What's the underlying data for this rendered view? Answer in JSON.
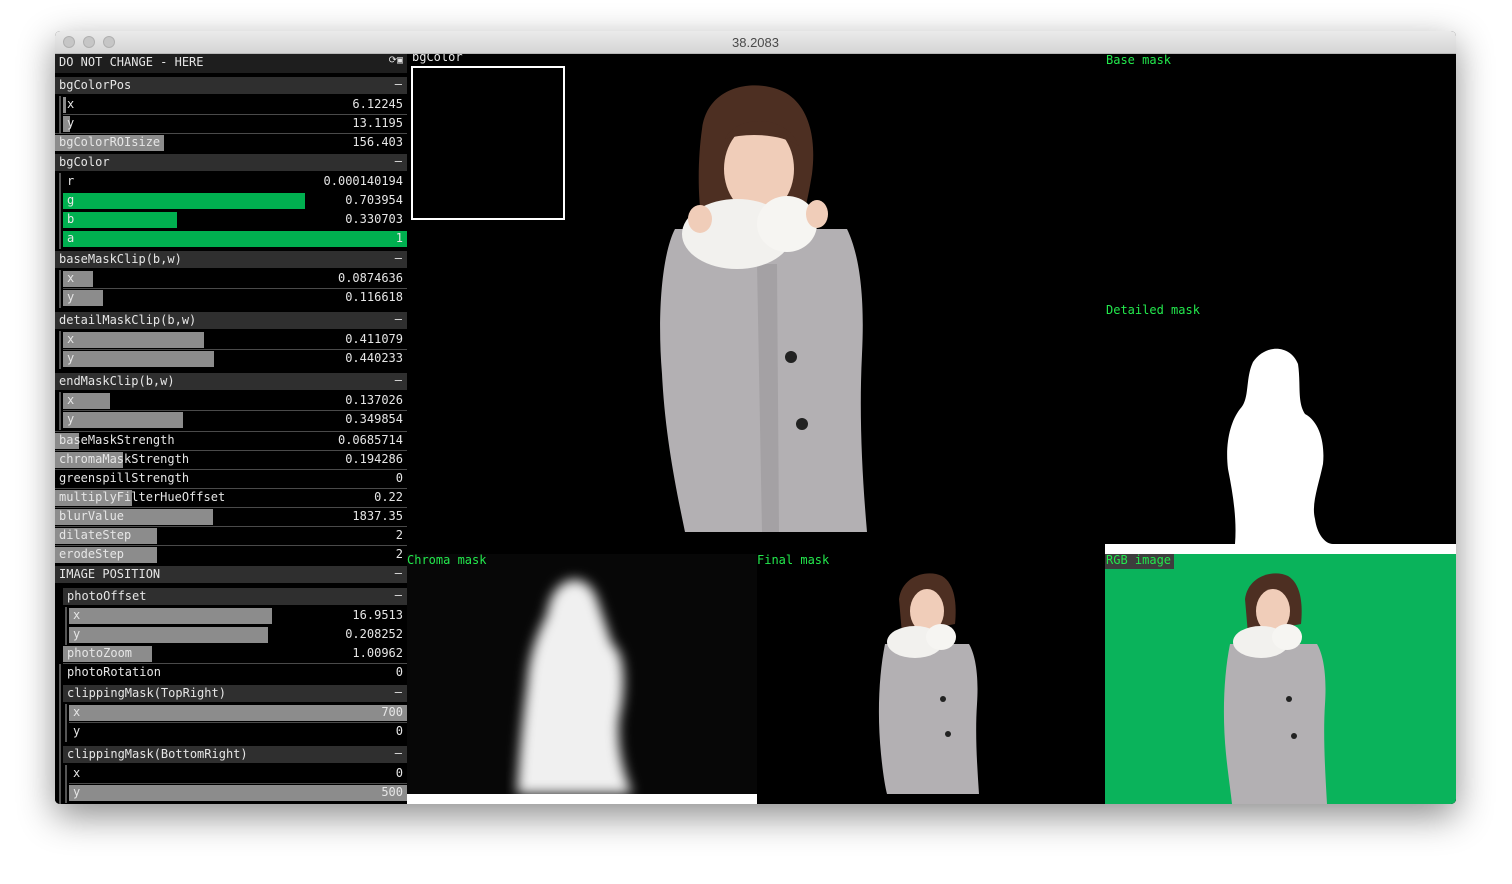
{
  "window": {
    "title": "38.2083"
  },
  "gui": {
    "title": "DO NOT CHANGE - HERE",
    "title_icons": [
      "refresh-icon",
      "save-icon"
    ],
    "groups": [
      {
        "name": "bgColorPos",
        "params": [
          {
            "label": "x",
            "value": "6.12245",
            "fill": 0.01
          },
          {
            "label": "y",
            "value": "13.1195",
            "fill": 0.02
          }
        ]
      },
      {
        "name": "bgColorROIsize",
        "value": "156.403",
        "fill": 0.31,
        "single": true
      },
      {
        "name": "bgColor",
        "params": [
          {
            "label": "r",
            "value": "0.000140194",
            "fill": 0.0
          },
          {
            "label": "g",
            "value": "0.703954",
            "fill": 0.704
          },
          {
            "label": "b",
            "value": "0.330703",
            "fill": 0.331
          },
          {
            "label": "a",
            "value": "1",
            "fill": 1.0
          }
        ]
      },
      {
        "name": "baseMaskClip(b,w)",
        "params": [
          {
            "label": "x",
            "value": "0.0874636",
            "fill": 0.087
          },
          {
            "label": "y",
            "value": "0.116618",
            "fill": 0.117
          }
        ]
      },
      {
        "name": "detailMaskClip(b,w)",
        "params": [
          {
            "label": "x",
            "value": "0.411079",
            "fill": 0.411
          },
          {
            "label": "y",
            "value": "0.440233",
            "fill": 0.44
          }
        ]
      },
      {
        "name": "endMaskClip(b,w)",
        "params": [
          {
            "label": "x",
            "value": "0.137026",
            "fill": 0.137
          },
          {
            "label": "y",
            "value": "0.349854",
            "fill": 0.35
          }
        ]
      }
    ],
    "sliders": [
      {
        "label": "baseMaskStrength",
        "value": "0.0685714",
        "fill": 0.069
      },
      {
        "label": "chromaMaskStrength",
        "value": "0.194286",
        "fill": 0.194
      },
      {
        "label": "greenspillStrength",
        "value": "0",
        "fill": 0.0
      },
      {
        "label": "multiplyFilterHueOffset",
        "value": "0.22",
        "fill": 0.22
      },
      {
        "label": "blurValue",
        "value": "1837.35",
        "fill": 0.45
      },
      {
        "label": "dilateStep",
        "value": "2",
        "fill": 0.29
      },
      {
        "label": "erodeStep",
        "value": "2",
        "fill": 0.29
      }
    ],
    "image_position": {
      "name": "IMAGE POSITION",
      "photoOffset": {
        "name": "photoOffset",
        "params": [
          {
            "label": "x",
            "value": "16.9513",
            "fill": 0.6
          },
          {
            "label": "y",
            "value": "0.208252",
            "fill": 0.59
          }
        ]
      },
      "photoZoom": {
        "label": "photoZoom",
        "value": "1.00962",
        "fill": 0.26
      },
      "photoRotation": {
        "label": "photoRotation",
        "value": "0",
        "fill": 0.0
      },
      "clipTopRight": {
        "name": "clippingMask(TopRight)",
        "params": [
          {
            "label": "x",
            "value": "700",
            "fill": 1.0
          },
          {
            "label": "y",
            "value": "0",
            "fill": 0.0
          }
        ]
      },
      "clipBottomRight": {
        "name": "clippingMask(BottomRight)",
        "params": [
          {
            "label": "x",
            "value": "0",
            "fill": 0.0
          },
          {
            "label": "y",
            "value": "500",
            "fill": 1.0
          }
        ]
      }
    },
    "minimize_symbol": "–"
  },
  "views": {
    "bgcolor_label": "bgColor",
    "base_mask_label": "Base mask",
    "detailed_mask_label": "Detailed mask",
    "chroma_mask_label": "Chroma mask",
    "final_mask_label": "Final mask",
    "rgb_image_label": "RGB image"
  },
  "colors": {
    "panel_header": "#2f2f2f",
    "slider_fill": "#8c8c8c",
    "green_fill": "#00b050",
    "label_green": "#23e94d",
    "greenscreen": "#0ab35b"
  }
}
